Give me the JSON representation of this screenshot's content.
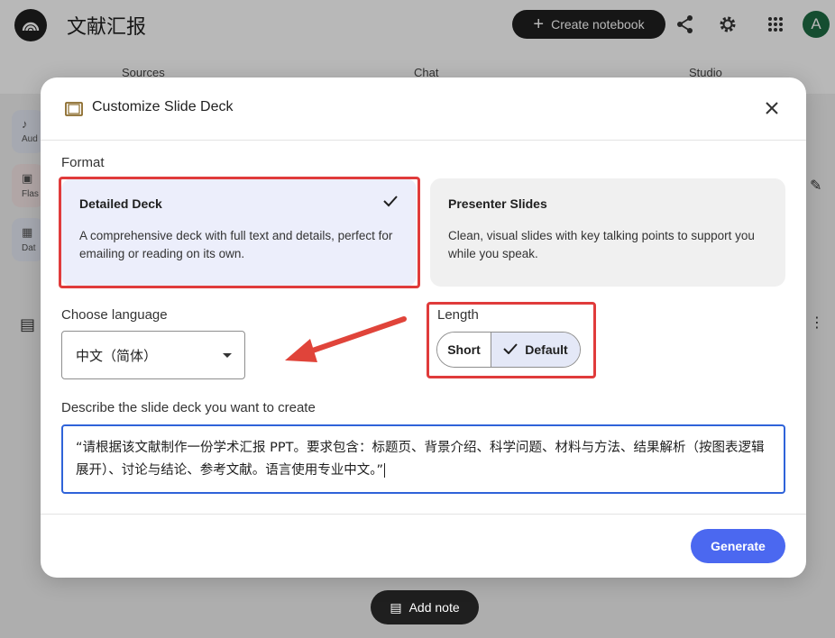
{
  "header": {
    "title": "文献汇报",
    "create_label": "Create notebook",
    "avatar_letter": "A"
  },
  "panels": {
    "sources": "Sources",
    "chat": "Chat",
    "studio": "Studio"
  },
  "side_chips": [
    {
      "label": "Aud",
      "icon": "audio-icon"
    },
    {
      "label": "Flas",
      "icon": "flashcard-icon"
    },
    {
      "label": "Dat",
      "icon": "table-icon"
    }
  ],
  "footer": {
    "add_note_label": "Add note"
  },
  "modal": {
    "title": "Customize Slide Deck",
    "format_label": "Format",
    "formats": [
      {
        "title": "Detailed Deck",
        "desc": "A comprehensive deck with full text and details, perfect for emailing or reading on its own.",
        "selected": true
      },
      {
        "title": "Presenter Slides",
        "desc": "Clean, visual slides with key talking points to support you while you speak.",
        "selected": false
      }
    ],
    "language_label": "Choose language",
    "language_value": "中文（简体）",
    "length_label": "Length",
    "length_options": [
      "Short",
      "Default"
    ],
    "length_selected": "Default",
    "prompt_label": "Describe the slide deck you want to create",
    "prompt_value": "“请根据该文献制作一份学术汇报 PPT。要求包含：标题页、背景介绍、科学问题、材料与方法、结果解析（按图表逻辑展开）、讨论与结论、参考文献。语言使用专业中文。”",
    "generate_label": "Generate"
  },
  "colors": {
    "accent": "#4b68f0",
    "highlight_red": "#e03b3b",
    "selected_card": "#eceefb",
    "input_focus": "#2f63d9"
  }
}
